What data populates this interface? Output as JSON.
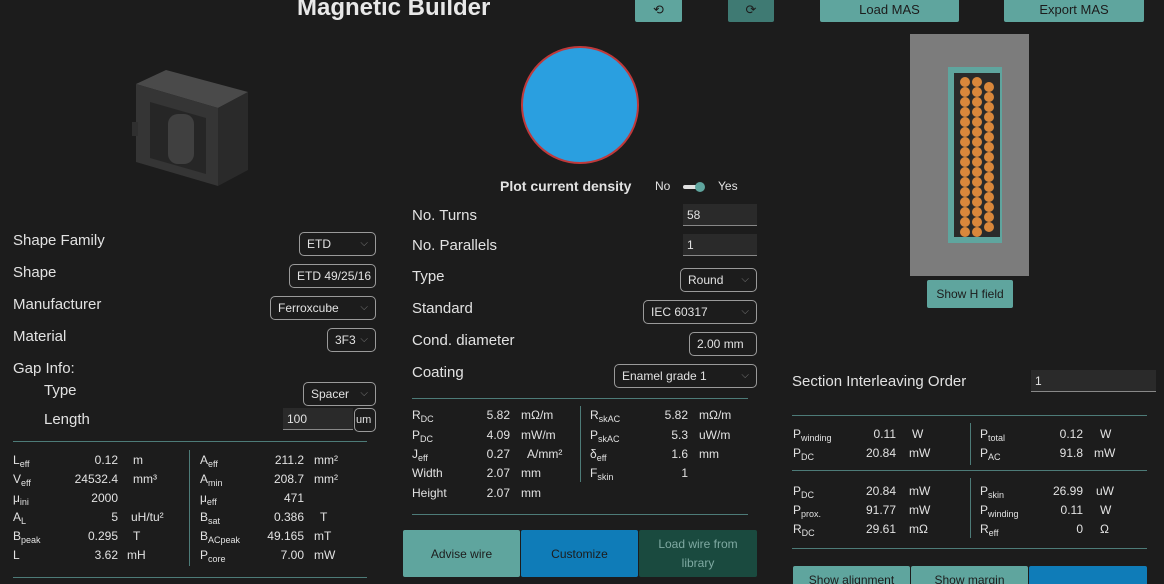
{
  "header": {
    "title": "Magnetic Builder",
    "load_label": "Load MAS",
    "export_label": "Export MAS"
  },
  "core": {
    "fields": [
      {
        "label": "Shape Family",
        "value": "ETD"
      },
      {
        "label": "Shape",
        "value": "ETD 49/25/16"
      },
      {
        "label": "Manufacturer",
        "value": "Ferroxcube"
      },
      {
        "label": "Material",
        "value": "3F3"
      }
    ],
    "gap_label": "Gap Info:",
    "gap_type_label": "Type",
    "gap_type": "Spacer",
    "gap_length_label": "Length",
    "gap_length": "100",
    "gap_unit": "um",
    "params_left": [
      {
        "name": "L",
        "sub": "eff",
        "value": "0.12",
        "unit": "m"
      },
      {
        "name": "V",
        "sub": "eff",
        "value": "24532.4",
        "unit": "mm³"
      },
      {
        "name": "μ",
        "sub": "ini",
        "value": "2000",
        "unit": ""
      },
      {
        "name": "A",
        "sub": "L",
        "value": "5",
        "unit": "uH/tu²"
      },
      {
        "name": "B",
        "sub": "peak",
        "value": "0.295",
        "unit": "T"
      },
      {
        "name": "L",
        "sub": "",
        "value": "3.62",
        "unit": "mH"
      }
    ],
    "params_right": [
      {
        "name": "A",
        "sub": "eff",
        "value": "211.2",
        "unit": "mm²"
      },
      {
        "name": "A",
        "sub": "min",
        "value": "208.7",
        "unit": "mm²"
      },
      {
        "name": "μ",
        "sub": "eff",
        "value": "471",
        "unit": ""
      },
      {
        "name": "B",
        "sub": "sat",
        "value": "0.386",
        "unit": "T"
      },
      {
        "name": "B",
        "sub": "ACpeak",
        "value": "49.165",
        "unit": "mT"
      },
      {
        "name": "P",
        "sub": "core",
        "value": "7.00",
        "unit": "mW"
      }
    ]
  },
  "wire": {
    "plot_label": "Plot current density",
    "no_label": "No",
    "yes_label": "Yes",
    "fields": [
      {
        "label": "No. Turns",
        "value": "58"
      },
      {
        "label": "No. Parallels",
        "value": "1"
      },
      {
        "label": "Type",
        "value": "Round"
      },
      {
        "label": "Standard",
        "value": "IEC 60317"
      },
      {
        "label": "Cond. diameter",
        "value": "2.00 mm"
      },
      {
        "label": "Coating",
        "value": "Enamel grade 1"
      }
    ],
    "params_left": [
      {
        "name": "R",
        "sub": "DC",
        "value": "5.82",
        "unit": "mΩ/m"
      },
      {
        "name": "P",
        "sub": "DC",
        "value": "4.09",
        "unit": "mW/m"
      },
      {
        "name": "J",
        "sub": "eff",
        "value": "0.27",
        "unit": "A/mm²"
      },
      {
        "name": "Width",
        "sub": "",
        "value": "2.07",
        "unit": "mm"
      },
      {
        "name": "Height",
        "sub": "",
        "value": "2.07",
        "unit": "mm"
      }
    ],
    "params_right": [
      {
        "name": "R",
        "sub": "skAC",
        "value": "5.82",
        "unit": "mΩ/m"
      },
      {
        "name": "P",
        "sub": "skAC",
        "value": "5.3",
        "unit": "uW/m"
      },
      {
        "name": "δ",
        "sub": "eff",
        "value": "1.6",
        "unit": "mm"
      },
      {
        "name": "F",
        "sub": "skin",
        "value": "1",
        "unit": ""
      }
    ],
    "advise_label": "Advise wire",
    "customize_label": "Customize",
    "library_label": "Load wire from library"
  },
  "winding": {
    "show_h_label": "Show H field",
    "interleave_label": "Section Interleaving Order",
    "interleave_value": "1",
    "losses_a_left": [
      {
        "name": "P",
        "sub": "winding",
        "value": "0.11",
        "unit": "W"
      },
      {
        "name": "P",
        "sub": "DC",
        "value": "20.84",
        "unit": "mW"
      }
    ],
    "losses_a_right": [
      {
        "name": "P",
        "sub": "total",
        "value": "0.12",
        "unit": "W"
      },
      {
        "name": "P",
        "sub": "AC",
        "value": "91.8",
        "unit": "mW"
      }
    ],
    "losses_b_left": [
      {
        "name": "P",
        "sub": "DC",
        "value": "20.84",
        "unit": "mW"
      },
      {
        "name": "P",
        "sub": "prox.",
        "value": "91.77",
        "unit": "mW"
      },
      {
        "name": "R",
        "sub": "DC",
        "value": "29.61",
        "unit": "mΩ"
      }
    ],
    "losses_b_right": [
      {
        "name": "P",
        "sub": "skin",
        "value": "26.99",
        "unit": "uW"
      },
      {
        "name": "P",
        "sub": "winding",
        "value": "0.11",
        "unit": "W"
      },
      {
        "name": "R",
        "sub": "eff",
        "value": "0",
        "unit": "Ω"
      }
    ],
    "show_alignment_label": "Show alignment",
    "show_margin_label": "Show margin"
  },
  "colors": {
    "accent": "#5fa59e",
    "button_blue": "#0f7cb8",
    "button_dark": "#1a4a3f",
    "wire_fill": "#2a9fe0",
    "wire_edge": "#c0393b",
    "turn": "#d9873b"
  }
}
